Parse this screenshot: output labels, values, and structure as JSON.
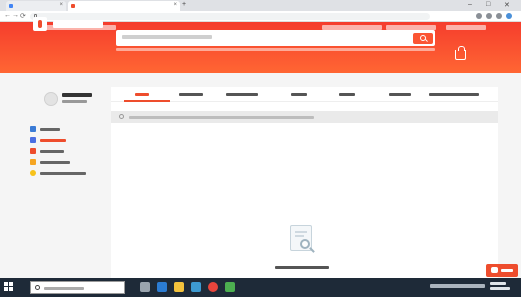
{
  "browser": {
    "tabs": [
      {
        "title": "",
        "active": false
      },
      {
        "title": "",
        "active": true
      }
    ],
    "url": "",
    "window_controls": [
      "–",
      "□",
      "✕"
    ],
    "nav_glyphs": [
      "←",
      "→",
      "⟳"
    ]
  },
  "header": {
    "top_links": [
      "",
      "",
      "",
      ""
    ],
    "top_right_links": [
      "",
      "",
      ""
    ],
    "logo_text": "",
    "search": {
      "placeholder": "",
      "value": ""
    },
    "search_suggestions": [
      "",
      "",
      "",
      ""
    ]
  },
  "sidebar": {
    "username": "",
    "edit_profile": "",
    "items": [
      {
        "label": "",
        "icon": "user-icon",
        "active": false
      },
      {
        "label": "",
        "icon": "orders-icon",
        "active": true
      },
      {
        "label": "",
        "icon": "bell-icon",
        "active": false
      },
      {
        "label": "",
        "icon": "voucher-icon",
        "active": false
      },
      {
        "label": "",
        "icon": "coin-icon",
        "active": false
      }
    ]
  },
  "orders": {
    "tabs": [
      "",
      "",
      "",
      "",
      "",
      "",
      ""
    ],
    "active_tab": 0,
    "search_placeholder": "",
    "empty_message": ""
  },
  "chat": {
    "label": ""
  },
  "taskbar": {
    "search_placeholder": "",
    "clock_time": "",
    "clock_date": ""
  },
  "colors": {
    "brand": "#ee4d2d",
    "header_top": "#f53d2d",
    "header_bottom": "#ff6633",
    "taskbar": "#1e2a38"
  }
}
